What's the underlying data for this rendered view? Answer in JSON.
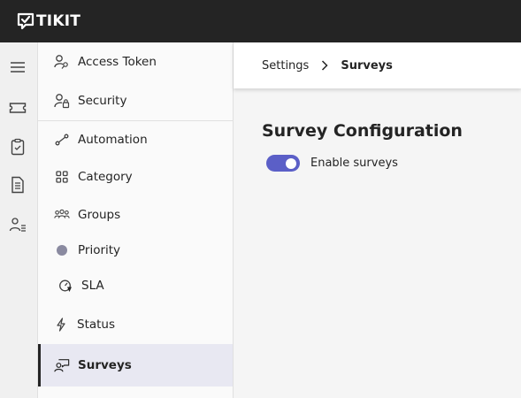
{
  "app": {
    "name": "TIKIT"
  },
  "rail": {
    "icons": [
      "menu-icon",
      "ticket-icon",
      "clipboard-icon",
      "document-icon",
      "people-list-icon"
    ]
  },
  "sidebar": {
    "items": [
      {
        "label": "Access Token",
        "icon": "key-person-icon"
      },
      {
        "label": "Security",
        "icon": "person-lock-icon"
      },
      {
        "label": "Automation",
        "icon": "flow-icon"
      },
      {
        "label": "Category",
        "icon": "grid-icon"
      },
      {
        "label": "Groups",
        "icon": "people-team-icon"
      },
      {
        "label": "Priority",
        "icon": "circle-icon"
      },
      {
        "label": "SLA",
        "icon": "gauge-icon"
      },
      {
        "label": "Status",
        "icon": "flash-icon"
      },
      {
        "label": "Surveys",
        "icon": "person-feedback-icon",
        "active": true
      }
    ]
  },
  "breadcrumb": {
    "parent": "Settings",
    "current": "Surveys"
  },
  "main": {
    "title": "Survey Configuration",
    "toggle": {
      "label": "Enable surveys",
      "enabled": true
    }
  },
  "colors": {
    "accent": "#5b5fc7",
    "topbar": "#242424",
    "active_bg": "#e8e8f2"
  }
}
